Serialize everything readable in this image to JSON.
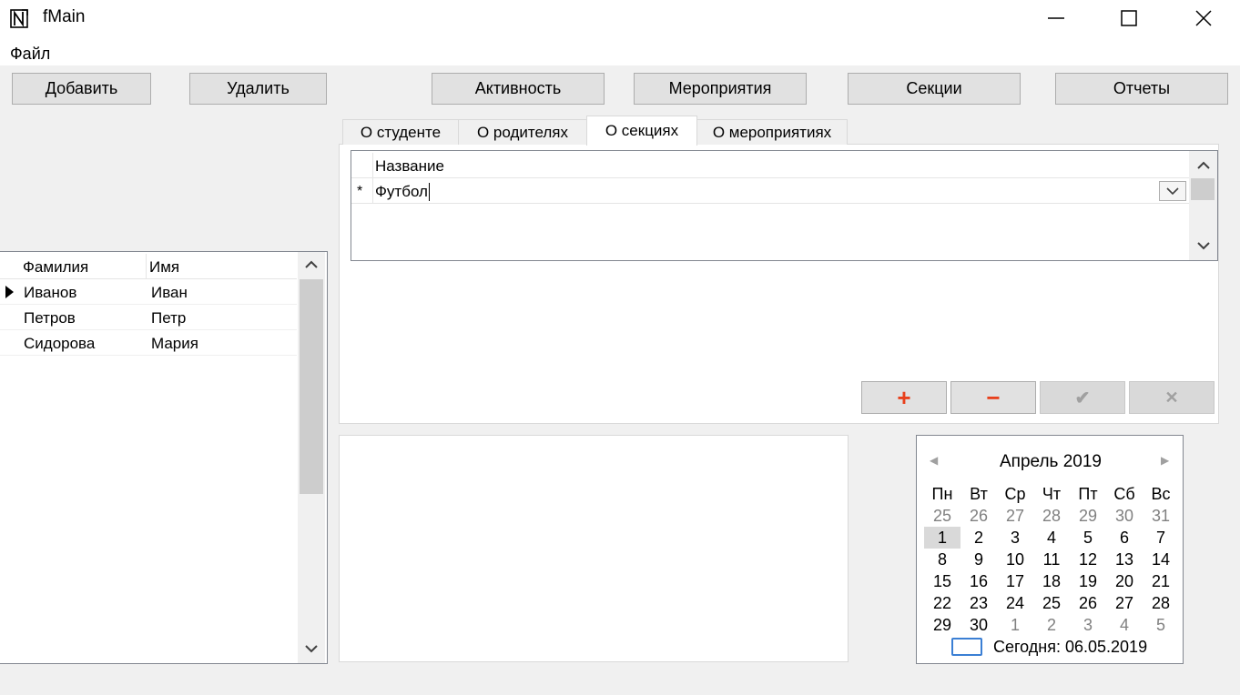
{
  "window": {
    "title": "fMain",
    "minimize_glyph": "—",
    "maximize_glyph": "☐",
    "close_glyph": "✕"
  },
  "menu": {
    "file": "Файл"
  },
  "toolbar": {
    "add": "Добавить",
    "delete": "Удалить",
    "activity": "Активность",
    "events": "Мероприятия",
    "sections": "Секции",
    "reports": "Отчеты"
  },
  "students_grid": {
    "columns": [
      "Фамилия",
      "Имя"
    ],
    "rows": [
      {
        "last_name": "Иванов",
        "first_name": "Иван"
      },
      {
        "last_name": "Петров",
        "first_name": "Петр"
      },
      {
        "last_name": "Сидорова",
        "first_name": "Мария"
      }
    ],
    "current_row": 0
  },
  "tabs": {
    "items": [
      "О студенте",
      "О родителях",
      "О секциях",
      "О мероприятиях"
    ],
    "active": "О секциях"
  },
  "sections_grid": {
    "column": "Название",
    "new_row_marker": "*",
    "value": "Футбол"
  },
  "navigator": {
    "add_glyph": "+",
    "remove_glyph": "−",
    "post_glyph": "✔",
    "cancel_glyph": "✕",
    "colors": {
      "add": "#e8401c",
      "remove": "#e8401c",
      "disabled": "#a0a0a0"
    }
  },
  "calendar": {
    "month_year": "Апрель 2019",
    "prev_glyph": "◀",
    "next_glyph": "▶",
    "weekdays": [
      "Пн",
      "Вт",
      "Ср",
      "Чт",
      "Пт",
      "Сб",
      "Вс"
    ],
    "weeks": [
      [
        "25",
        "26",
        "27",
        "28",
        "29",
        "30",
        "31"
      ],
      [
        "1",
        "2",
        "3",
        "4",
        "5",
        "6",
        "7"
      ],
      [
        "8",
        "9",
        "10",
        "11",
        "12",
        "13",
        "14"
      ],
      [
        "15",
        "16",
        "17",
        "18",
        "19",
        "20",
        "21"
      ],
      [
        "22",
        "23",
        "24",
        "25",
        "26",
        "27",
        "28"
      ],
      [
        "29",
        "30",
        "1",
        "2",
        "3",
        "4",
        "5"
      ]
    ],
    "muted": [
      [
        0,
        0
      ],
      [
        0,
        1
      ],
      [
        0,
        2
      ],
      [
        0,
        3
      ],
      [
        0,
        4
      ],
      [
        0,
        5
      ],
      [
        0,
        6
      ],
      [
        5,
        2
      ],
      [
        5,
        3
      ],
      [
        5,
        4
      ],
      [
        5,
        5
      ],
      [
        5,
        6
      ]
    ],
    "selected": [
      1,
      0
    ],
    "today_label": "Сегодня: 06.05.2019",
    "today_color": "#3b7fd4"
  }
}
